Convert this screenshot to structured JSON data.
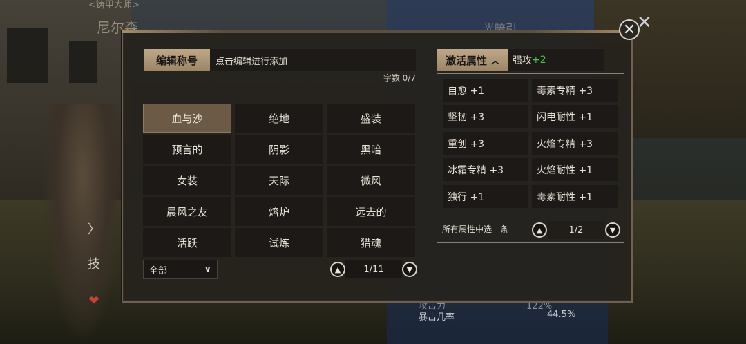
{
  "background": {
    "npc_title": "<铸甲大师>",
    "npc_name": "尼尔森",
    "npc_name_2": "光暗引",
    "stats": [
      {
        "label": "攻击力",
        "value": "122%"
      },
      {
        "label": "暴击几率",
        "value": "44.5%"
      }
    ],
    "side_buttons": {
      "skill": "技",
      "heart": "❤",
      "arrow": "〉"
    }
  },
  "editor": {
    "label": "编辑称号",
    "placeholder": "点击编辑进行添加",
    "char_count": "字数 0/7"
  },
  "titles": [
    {
      "label": "血与沙",
      "selected": true
    },
    {
      "label": "绝地"
    },
    {
      "label": "盛装"
    },
    {
      "label": "预言的"
    },
    {
      "label": "阴影"
    },
    {
      "label": "黑暗"
    },
    {
      "label": "女装"
    },
    {
      "label": "天际"
    },
    {
      "label": "微风"
    },
    {
      "label": "晨风之友"
    },
    {
      "label": "熔炉"
    },
    {
      "label": "远去的"
    },
    {
      "label": "活跃"
    },
    {
      "label": "试炼"
    },
    {
      "label": "猎魂"
    }
  ],
  "filter": {
    "selected": "全部"
  },
  "title_pager": {
    "page": "1/11"
  },
  "activate": {
    "label": "激活属性",
    "value_prefix": "强攻",
    "value_bonus": "+2"
  },
  "attributes": [
    {
      "label": "自愈 +1"
    },
    {
      "label": "毒素专精 +3"
    },
    {
      "label": "坚韧 +3"
    },
    {
      "label": "闪电耐性 +1"
    },
    {
      "label": "重创 +3"
    },
    {
      "label": "火焰专精 +3"
    },
    {
      "label": "冰霜专精 +3"
    },
    {
      "label": "火焰耐性 +1"
    },
    {
      "label": "独行 +1"
    },
    {
      "label": "毒素耐性 +1"
    }
  ],
  "attr_hint": "所有属性中选一条",
  "attr_pager": {
    "page": "1/2"
  },
  "colors": {
    "accent_tan": "#bfa88a",
    "selected_cell": "#6b5a45",
    "bonus_green": "#4cc34a"
  },
  "icons": {
    "close": "close-icon",
    "up": "chevron-up-icon",
    "down": "chevron-down-icon"
  }
}
